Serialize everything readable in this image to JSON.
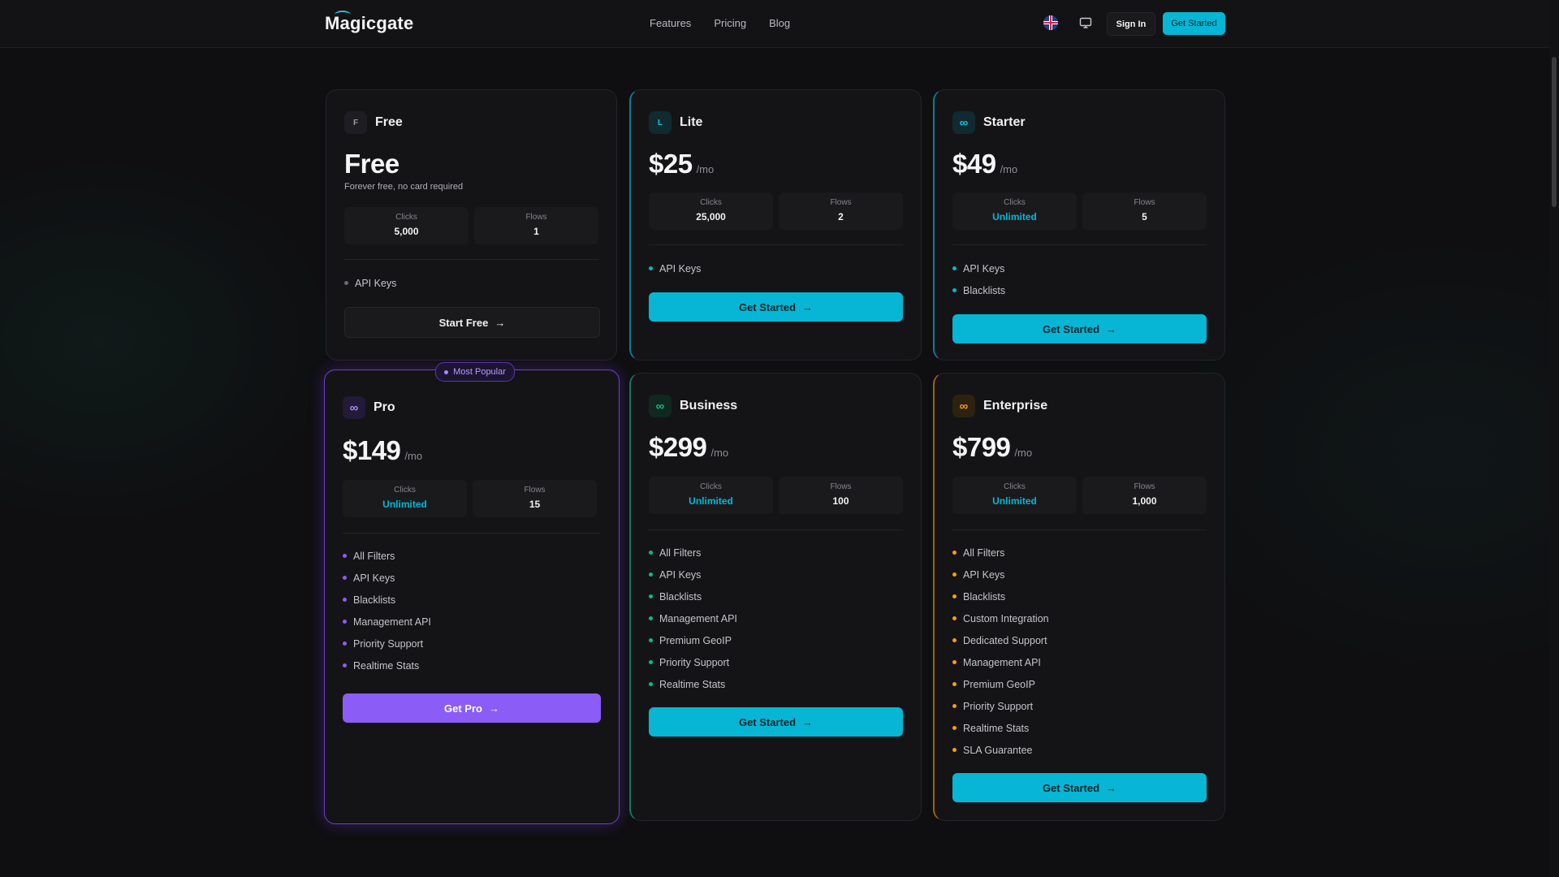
{
  "header": {
    "logo": "Magicgate",
    "nav": [
      "Features",
      "Pricing",
      "Blog"
    ],
    "sign_in": "Sign In",
    "get_started": "Get Started",
    "icons": [
      "flag-icon",
      "monitor-icon"
    ]
  },
  "colors": {
    "accent_cyan": "#06b6d4",
    "accent_purple": "#8b5cf6",
    "accent_green": "#10b981",
    "accent_orange": "#f59e0b"
  },
  "plans": [
    {
      "name": "Free",
      "badge": "F",
      "price": "Free",
      "per": "",
      "subtitle": "Forever free, no card required",
      "clicks_label": "Clicks",
      "clicks": "5,000",
      "flows_label": "Flows",
      "flows": "1",
      "features": [
        "API Keys"
      ],
      "cta": "Start Free"
    },
    {
      "name": "Lite",
      "badge": "L",
      "price": "$25",
      "per": "/mo",
      "clicks_label": "Clicks",
      "clicks": "25,000",
      "flows_label": "Flows",
      "flows": "2",
      "features": [
        "API Keys"
      ],
      "cta": "Get Started"
    },
    {
      "name": "Starter",
      "badge": "∞",
      "price": "$49",
      "per": "/mo",
      "clicks_label": "Clicks",
      "clicks": "Unlimited",
      "flows_label": "Flows",
      "flows": "5",
      "features": [
        "API Keys",
        "Blacklists"
      ],
      "cta": "Get Started"
    },
    {
      "name": "Pro",
      "badge": "∞",
      "price": "$149",
      "per": "/mo",
      "tag": "Most Popular",
      "clicks_label": "Clicks",
      "clicks": "Unlimited",
      "flows_label": "Flows",
      "flows": "15",
      "features": [
        "All Filters",
        "API Keys",
        "Blacklists",
        "Management API",
        "Priority Support",
        "Realtime Stats"
      ],
      "cta": "Get Pro"
    },
    {
      "name": "Business",
      "badge": "∞",
      "price": "$299",
      "per": "/mo",
      "clicks_label": "Clicks",
      "clicks": "Unlimited",
      "flows_label": "Flows",
      "flows": "100",
      "features": [
        "All Filters",
        "API Keys",
        "Blacklists",
        "Management API",
        "Premium GeoIP",
        "Priority Support",
        "Realtime Stats"
      ],
      "cta": "Get Started"
    },
    {
      "name": "Enterprise",
      "badge": "∞",
      "price": "$799",
      "per": "/mo",
      "clicks_label": "Clicks",
      "clicks": "Unlimited",
      "flows_label": "Flows",
      "flows": "1,000",
      "features": [
        "All Filters",
        "API Keys",
        "Blacklists",
        "Custom Integration",
        "Dedicated Support",
        "Management API",
        "Premium GeoIP",
        "Priority Support",
        "Realtime Stats",
        "SLA Guarantee"
      ],
      "cta": "Get Started"
    }
  ]
}
